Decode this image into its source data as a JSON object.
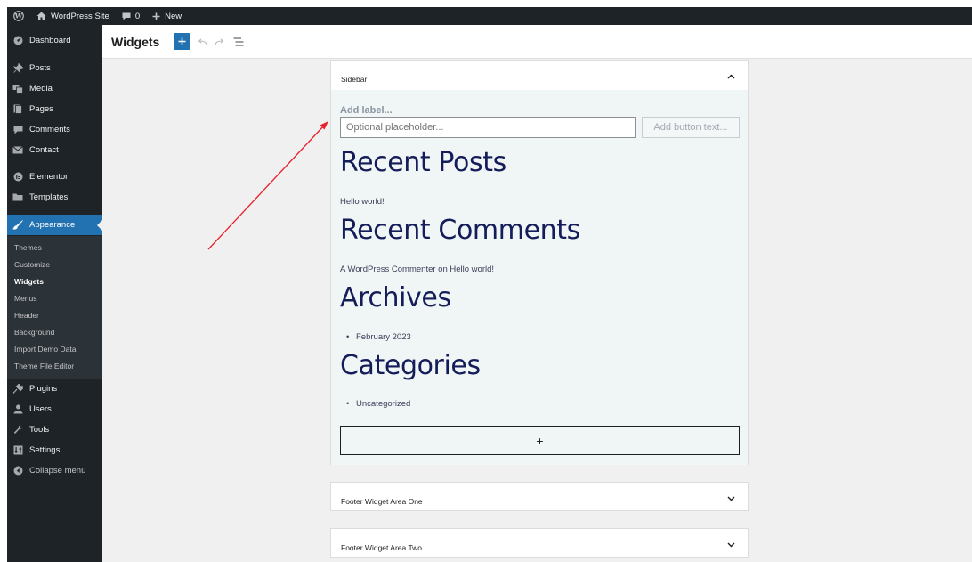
{
  "admin_bar": {
    "site_name": "WordPress Site",
    "comments_count": "0",
    "new_label": "New"
  },
  "sidebar": {
    "items": [
      {
        "label": "Dashboard",
        "icon": "dashboard-icon"
      },
      {
        "label": "Posts",
        "icon": "pin-icon"
      },
      {
        "label": "Media",
        "icon": "media-icon"
      },
      {
        "label": "Pages",
        "icon": "pages-icon"
      },
      {
        "label": "Comments",
        "icon": "comment-icon"
      },
      {
        "label": "Contact",
        "icon": "mail-icon"
      },
      {
        "label": "Elementor",
        "icon": "elementor-icon"
      },
      {
        "label": "Templates",
        "icon": "folder-icon"
      },
      {
        "label": "Appearance",
        "icon": "brush-icon"
      },
      {
        "label": "Plugins",
        "icon": "plug-icon"
      },
      {
        "label": "Users",
        "icon": "user-icon"
      },
      {
        "label": "Tools",
        "icon": "wrench-icon"
      },
      {
        "label": "Settings",
        "icon": "settings-icon"
      },
      {
        "label": "Collapse menu",
        "icon": "collapse-icon"
      }
    ],
    "appearance_submenu": [
      "Themes",
      "Customize",
      "Widgets",
      "Menus",
      "Header",
      "Background",
      "Import Demo Data",
      "Theme File Editor"
    ]
  },
  "editor": {
    "title": "Widgets"
  },
  "sidebar_panel": {
    "title": "Sidebar",
    "form_label": "Add label...",
    "input_placeholder": "Optional placeholder...",
    "button_placeholder": "Add button text...",
    "recent_posts_heading": "Recent Posts",
    "recent_post_item": "Hello world!",
    "recent_comments_heading": "Recent Comments",
    "comment_author": "A WordPress Commenter",
    "comment_on": "on",
    "comment_post": "Hello world!",
    "archives_heading": "Archives",
    "archive_item": "February 2023",
    "categories_heading": "Categories",
    "category_item": "Uncategorized",
    "add_block_symbol": "+"
  },
  "footer_panels": [
    {
      "title": "Footer Widget Area One"
    },
    {
      "title": "Footer Widget Area Two"
    }
  ],
  "colors": {
    "admin_dark": "#1d2327",
    "accent_blue": "#2271b1",
    "heading_navy": "#141c59",
    "annotation_red": "#e8202a"
  }
}
